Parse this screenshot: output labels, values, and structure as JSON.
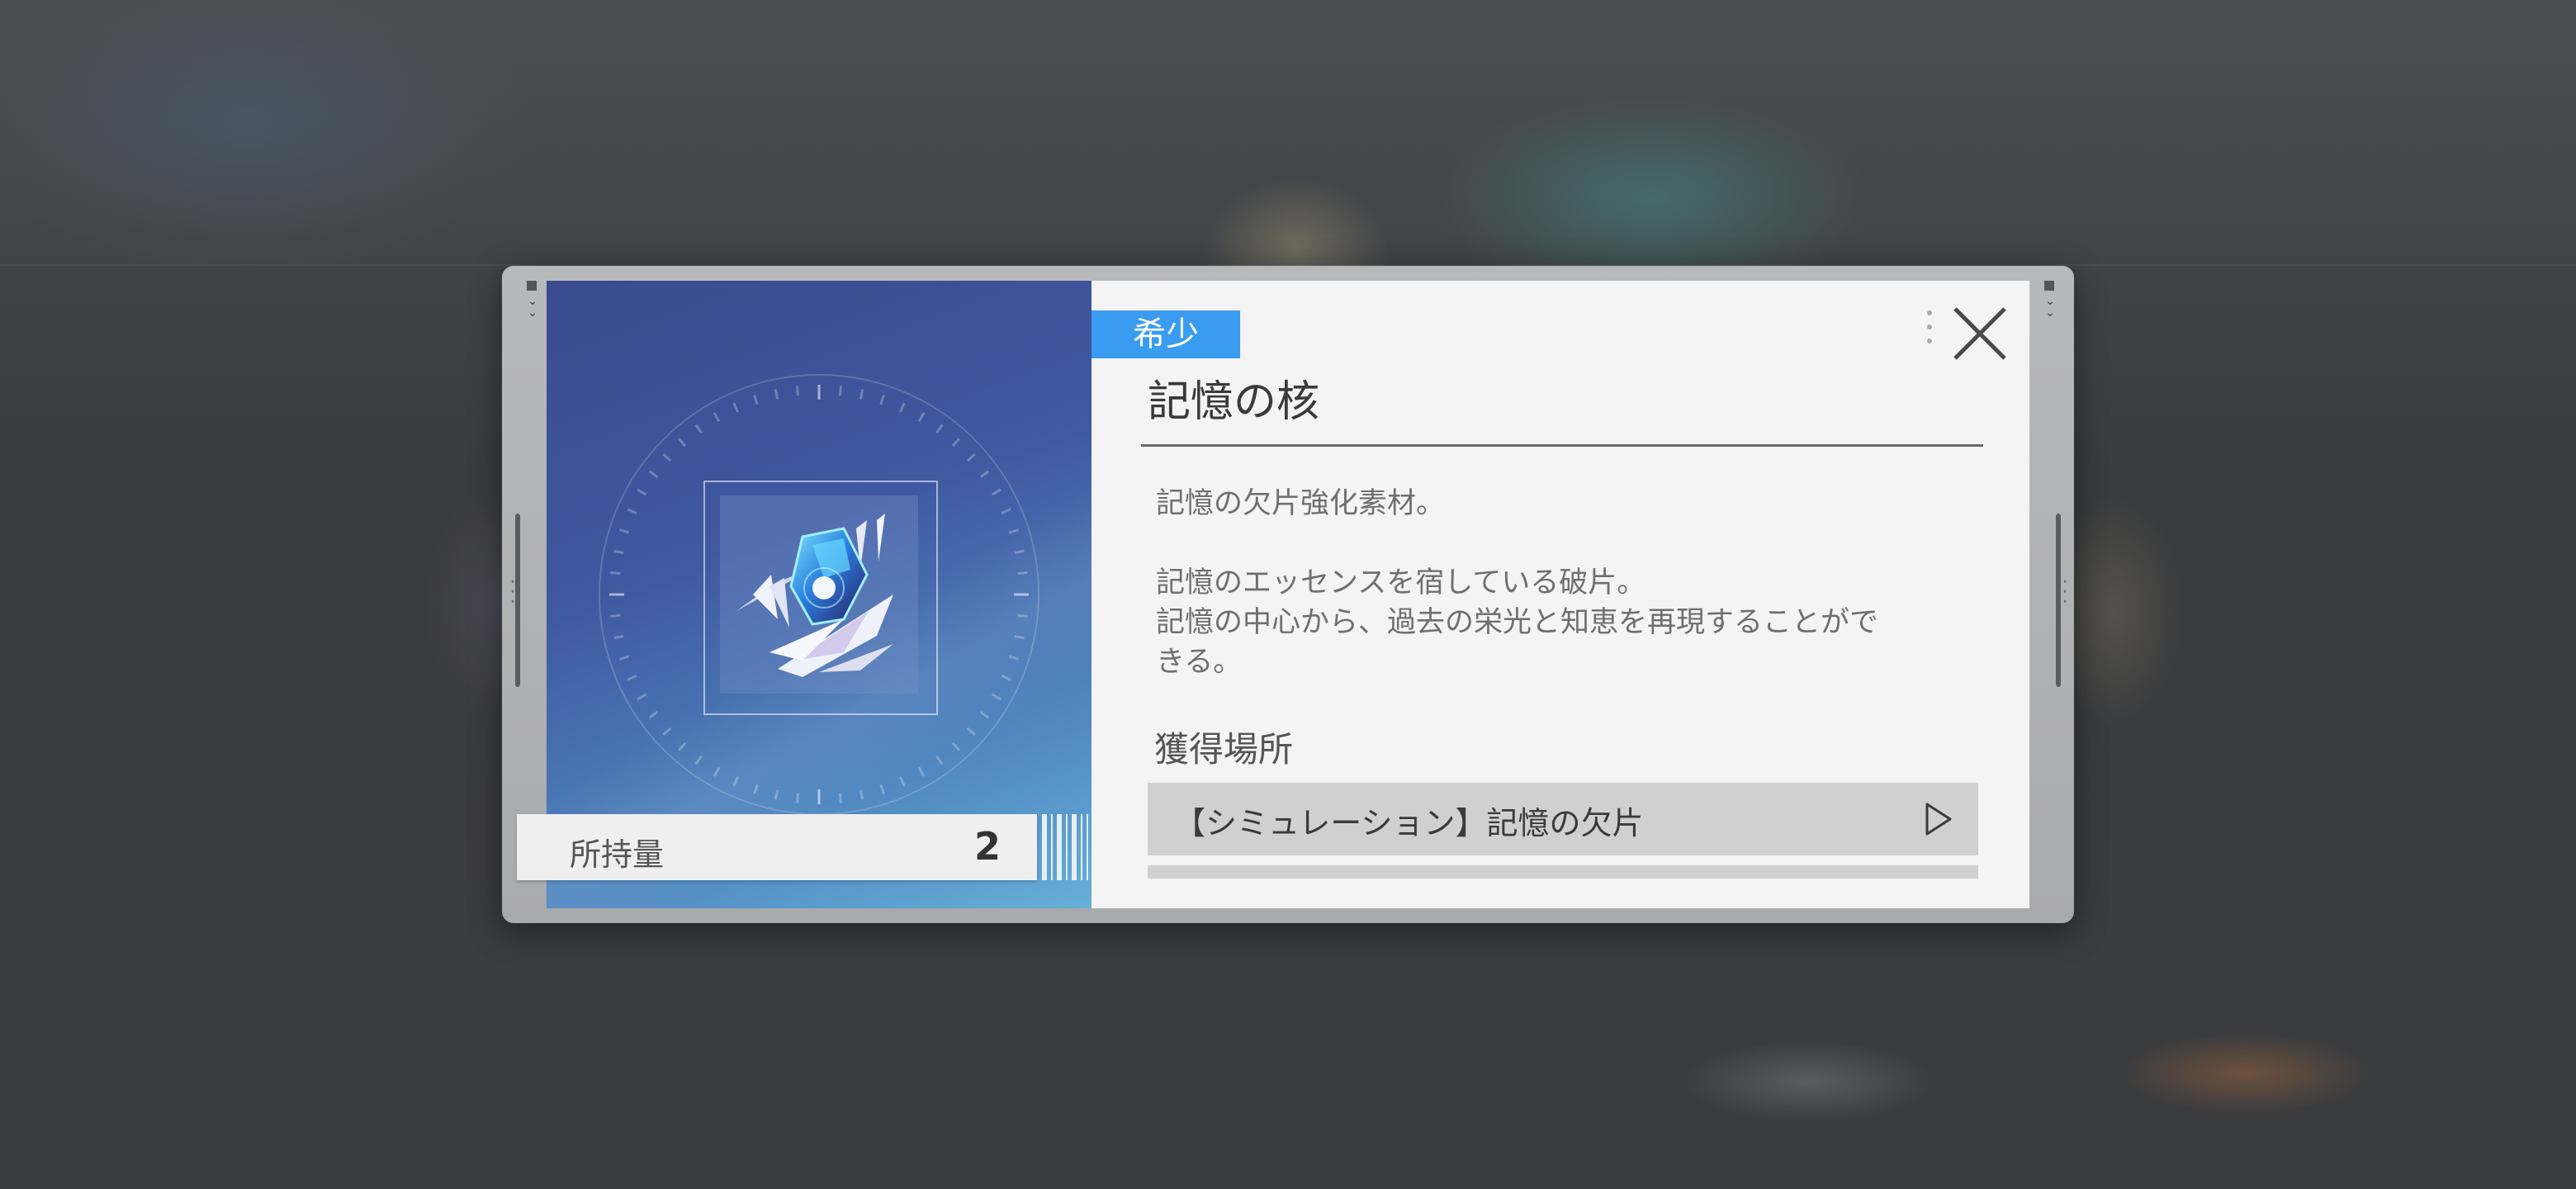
{
  "item": {
    "rarity": "希少",
    "name": "記憶の核",
    "description": [
      "記憶の欠片強化素材。",
      "",
      "記憶のエッセンスを宿している破片。",
      "記憶の中心から、過去の栄光と知恵を再現することがで",
      "きる。"
    ],
    "owned_label": "所持量",
    "owned_count": "2",
    "image_icon": "memory-core-crystal-icon"
  },
  "acquisition": {
    "heading": "獲得場所",
    "sources": [
      {
        "label": "【シミュレーション】記憶の欠片",
        "icon": "play-arrow-icon"
      }
    ]
  },
  "colors": {
    "rarity_badge": "#3a9cf0",
    "info_panel_bg": "#f4f4f4",
    "image_panel_top": "#3b4a90",
    "image_panel_bottom": "#66b0d8"
  }
}
